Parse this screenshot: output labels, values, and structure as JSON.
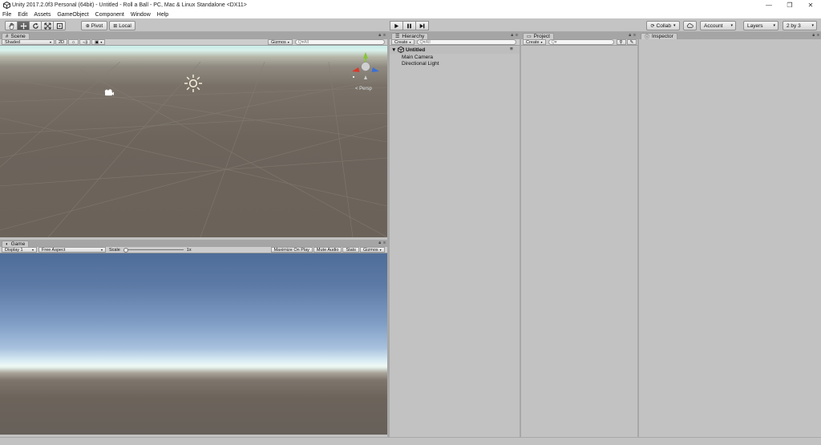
{
  "window": {
    "title": "Unity 2017.2.0f3 Personal (64bit) - Untitled - Roll a Ball - PC, Mac & Linux Standalone <DX11>",
    "minimize": "—",
    "restore": "❐",
    "close": "✕"
  },
  "menu": [
    "File",
    "Edit",
    "Assets",
    "GameObject",
    "Component",
    "Window",
    "Help"
  ],
  "toolbar": {
    "tools": [
      "hand-tool",
      "move-tool",
      "rotate-tool",
      "scale-tool",
      "rect-tool"
    ],
    "active_tool": "move-tool",
    "pivot_label": "Pivot",
    "local_label": "Local",
    "collab_label": "Collab",
    "account_label": "Account",
    "layers_label": "Layers",
    "layout_label": "2 by 3"
  },
  "scene": {
    "tab": "Scene",
    "shading": "Shaded",
    "mode_2d": "2D",
    "gizmos": "Gizmos",
    "search_placeholder": "Q▾All",
    "persp_label": "< Persp"
  },
  "game": {
    "tab": "Game",
    "display": "Display 1",
    "aspect": "Free Aspect",
    "scale_label": "Scale",
    "scale_value": "1x",
    "maximize": "Maximize On Play",
    "mute": "Mute Audio",
    "stats": "Stats",
    "gizmos": "Gizmos"
  },
  "hierarchy": {
    "tab": "Hierarchy",
    "create": "Create",
    "search_placeholder": "Q▾All",
    "scene_name": "Untitled",
    "items": [
      "Main Camera",
      "Directional Light"
    ]
  },
  "project": {
    "tab": "Project",
    "create": "Create"
  },
  "inspector": {
    "tab": "Inspector"
  },
  "colors": {
    "sky_top": "#c9ede9",
    "ground": "#6d655c",
    "game_sky": "#5c7aa5",
    "panel_bg": "#c2c2c2",
    "gizmo_x": "#d83a2c",
    "gizmo_y": "#86c438",
    "gizmo_z": "#3b6fd6"
  }
}
